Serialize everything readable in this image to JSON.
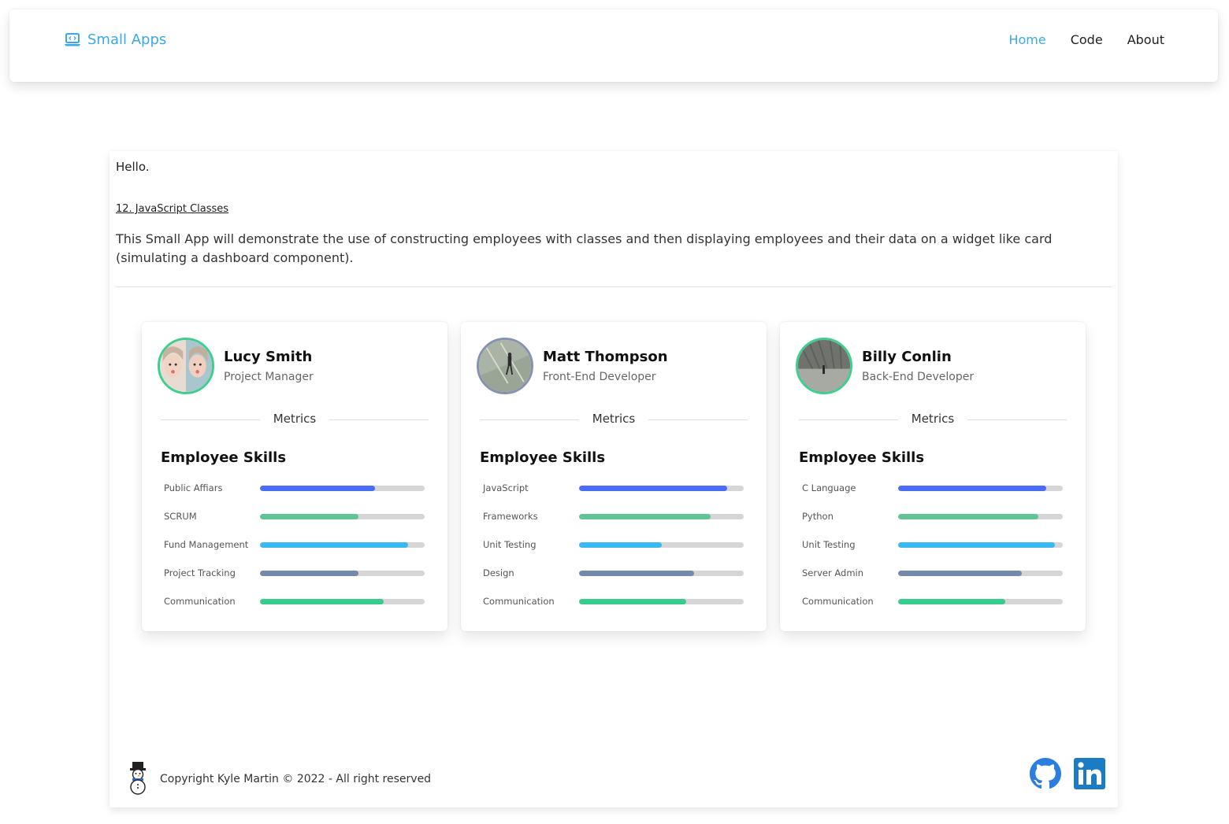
{
  "nav": {
    "brand": "Small Apps",
    "links": [
      "Home",
      "Code",
      "About"
    ],
    "active_index": 0,
    "accent_color": "#3aa9e6"
  },
  "intro": {
    "greeting": "Hello.",
    "link_text": "12. JavaScript Classes",
    "description": "This Small App will demonstrate the use of constructing employees with classes and then displaying employees and their data on a widget like card (simulating a dashboard component)."
  },
  "cards": [
    {
      "name": "Lucy Smith",
      "role": "Project Manager",
      "metrics_label": "Metrics",
      "skills_title": "Employee Skills",
      "avatar_border": "#3ecf8e",
      "skills": [
        {
          "label": "Public Affiars",
          "level": 0.7,
          "color": "#4a6cf7"
        },
        {
          "label": "SCRUM",
          "level": 0.6,
          "color": "#5fc596"
        },
        {
          "label": "Fund Management",
          "level": 0.9,
          "color": "#3ab8f2"
        },
        {
          "label": "Project Tracking",
          "level": 0.6,
          "color": "#7489ab"
        },
        {
          "label": "Communication",
          "level": 0.75,
          "color": "#38cb8e"
        }
      ]
    },
    {
      "name": "Matt Thompson",
      "role": "Front-End Developer",
      "metrics_label": "Metrics",
      "skills_title": "Employee Skills",
      "avatar_border": "#8593b0",
      "skills": [
        {
          "label": "JavaScript",
          "level": 0.9,
          "color": "#4a6cf7"
        },
        {
          "label": "Frameworks",
          "level": 0.8,
          "color": "#5fc596"
        },
        {
          "label": "Unit Testing",
          "level": 0.5,
          "color": "#3ab8f2"
        },
        {
          "label": "Design",
          "level": 0.7,
          "color": "#7489ab"
        },
        {
          "label": "Communication",
          "level": 0.65,
          "color": "#38cb8e"
        }
      ]
    },
    {
      "name": "Billy Conlin",
      "role": "Back-End Developer",
      "metrics_label": "Metrics",
      "skills_title": "Employee Skills",
      "avatar_border": "#3ecf8e",
      "skills": [
        {
          "label": "C Language",
          "level": 0.9,
          "color": "#4a6cf7"
        },
        {
          "label": "Python",
          "level": 0.85,
          "color": "#5fc596"
        },
        {
          "label": "Unit Testing",
          "level": 0.95,
          "color": "#3ab8f2"
        },
        {
          "label": "Server Admin",
          "level": 0.75,
          "color": "#7489ab"
        },
        {
          "label": "Communication",
          "level": 0.65,
          "color": "#38cb8e"
        }
      ]
    }
  ],
  "footer": {
    "copyright": "Copyright Kyle Martin © 2022 - All right reserved",
    "icons": [
      "snowman-icon",
      "github-icon",
      "linkedin-icon"
    ]
  }
}
